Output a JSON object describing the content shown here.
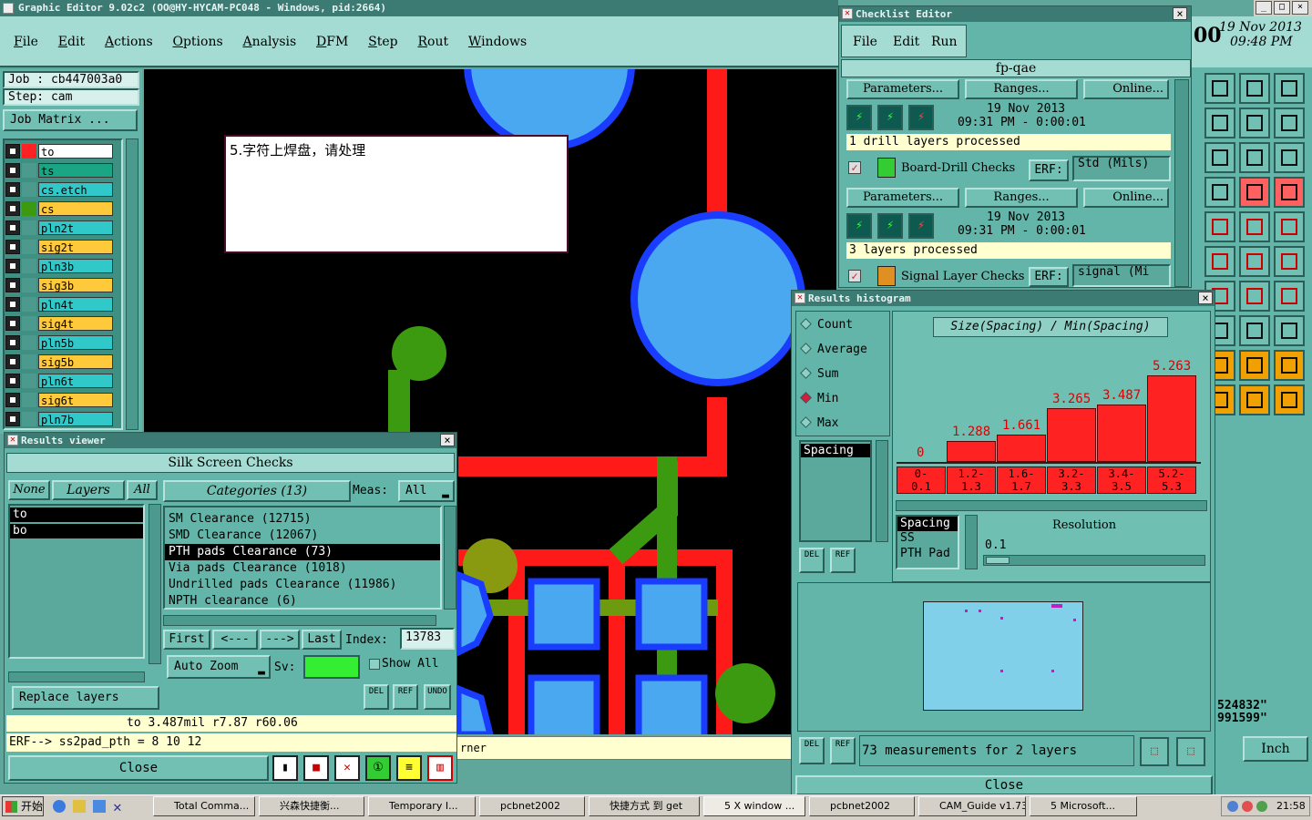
{
  "main_window": {
    "title": "Graphic Editor 9.02c2 (OO@HY-HYCAM-PC048 - Windows, pid:2664)"
  },
  "menu": [
    "File",
    "Edit",
    "Actions",
    "Options",
    "Analysis",
    "DFM",
    "Step",
    "Rout",
    "Windows"
  ],
  "job": {
    "job_label": "Job : cb447003a0",
    "step_label": "Step: cam",
    "matrix_btn": "Job Matrix ..."
  },
  "layers": [
    {
      "name": "to",
      "color": "#ffffff"
    },
    {
      "name": "ts",
      "color": "#1aa585"
    },
    {
      "name": "cs.etch",
      "color": "#30c8c8"
    },
    {
      "name": "cs",
      "color": "#ffc93c"
    },
    {
      "name": "pln2t",
      "color": "#30c8c8"
    },
    {
      "name": "sig2t",
      "color": "#ffc93c"
    },
    {
      "name": "pln3b",
      "color": "#30c8c8"
    },
    {
      "name": "sig3b",
      "color": "#ffc93c"
    },
    {
      "name": "pln4t",
      "color": "#30c8c8"
    },
    {
      "name": "sig4t",
      "color": "#ffc93c"
    },
    {
      "name": "pln5b",
      "color": "#30c8c8"
    },
    {
      "name": "sig5b",
      "color": "#ffc93c"
    },
    {
      "name": "pln6t",
      "color": "#30c8c8"
    },
    {
      "name": "sig6t",
      "color": "#ffc93c"
    },
    {
      "name": "pln7b",
      "color": "#30c8c8"
    }
  ],
  "note": {
    "text": "5.字符上焊盘，请处理"
  },
  "clock": {
    "prefix": "00",
    "date": "19 Nov 2013",
    "time": "09:48 PM"
  },
  "checklist": {
    "title": "Checklist Editor",
    "menu": [
      "File",
      "Edit",
      "Run"
    ],
    "name": "fp-qae",
    "btn_params": "Parameters...",
    "btn_ranges": "Ranges...",
    "btn_online": "Online...",
    "run1": {
      "date": "19 Nov 2013",
      "time": "09:31 PM - 0:00:01",
      "status": "1 drill layers processed"
    },
    "check1": {
      "name": "Board-Drill Checks",
      "erf": "ERF:",
      "erf_val": "Std (Mils)"
    },
    "run2": {
      "date": "19 Nov 2013",
      "time": "09:31 PM - 0:00:01",
      "status": "3 layers processed"
    },
    "check2": {
      "name": "Signal Layer Checks",
      "erf": "ERF:",
      "erf_val": "signal (Mi"
    }
  },
  "results_viewer": {
    "title": "Results viewer",
    "header": "Silk Screen Checks",
    "btn_none": "None",
    "btn_layers": "Layers",
    "btn_all": "All",
    "categories_label": "Categories (13)",
    "meas_label": "Meas:",
    "meas_value": "All",
    "layer_list": [
      "to",
      "bo"
    ],
    "categories": [
      "SM Clearance (12715)",
      "SMD Clearance (12067)",
      "PTH pads Clearance (73)",
      "Via pads Clearance (1018)",
      "Undrilled pads Clearance (11986)",
      "NPTH clearance (6)"
    ],
    "nav": {
      "first": "First",
      "prev": "<---",
      "next": "--->",
      "last": "Last",
      "index_label": "Index:",
      "index_value": "13783"
    },
    "auto_zoom": "Auto Zoom",
    "sv_label": "Sv:",
    "show_all": "Show All",
    "replace_layers": "Replace layers",
    "measure": "to 3.487mil    r7.87    r60.06",
    "erf_line": "ERF--> ss2pad_pth = 8 10 12",
    "close": "Close",
    "del": "DEL",
    "ref": "REF",
    "undo": "UNDO"
  },
  "histogram": {
    "title": "Results histogram",
    "modes": [
      "Count",
      "Average",
      "Sum",
      "Min",
      "Max"
    ],
    "selected_mode": "Min",
    "chart_title": "Size(Spacing) / Min(Spacing)",
    "measure_list": [
      "Spacing"
    ],
    "attr_list": [
      "Spacing",
      "SS",
      "PTH Pad"
    ],
    "resolution_label": "Resolution",
    "resolution_value": "0.1",
    "status": "73 measurements for 2 layers",
    "close": "Close",
    "del": "DEL",
    "ref": "REF"
  },
  "chart_data": {
    "type": "bar",
    "title": "Size(Spacing) / Min(Spacing)",
    "categories": [
      "0-0.1",
      "1.2-1.3",
      "1.6-1.7",
      "3.2-3.3",
      "3.4-3.5",
      "5.2-5.3"
    ],
    "bin_top": [
      "0-",
      "1.2-",
      "1.6-",
      "3.2-",
      "3.4-",
      "5.2-"
    ],
    "bin_bottom": [
      "0.1",
      "1.3",
      "1.7",
      "3.3",
      "3.5",
      "5.3"
    ],
    "values": [
      0,
      1.288,
      1.661,
      3.265,
      3.487,
      5.263
    ],
    "value_labels": [
      "0",
      "1.288",
      "1.661",
      "3.265",
      "3.487",
      "5.263"
    ],
    "ylim": [
      0,
      6
    ],
    "bar_color": "#ff2222"
  },
  "coords": {
    "x": "524832\"",
    "y": "991599\""
  },
  "units": "Inch",
  "status_bar": "rner",
  "taskbar": {
    "start": "开始",
    "items": [
      "Total Comma...",
      "兴森快捷衡...",
      "Temporary I...",
      "pcbnet2002",
      "快捷方式 到 get",
      "5 X window ...",
      "pcbnet2002",
      "CAM_Guide v1.73",
      "5 Microsoft..."
    ],
    "time": "21:58"
  }
}
